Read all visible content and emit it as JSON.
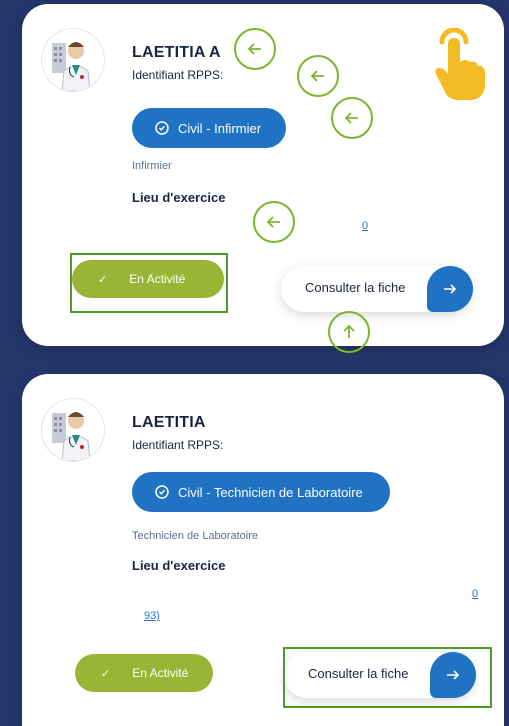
{
  "cards": [
    {
      "name": "LAETITIA A",
      "rpps_label": "Identifiant RPPS:",
      "specialty_button": "Civil - Infirmier",
      "profession": "Infirmier",
      "lieu_label": "Lieu d'exercice",
      "address_link": "0",
      "status": "En Activité",
      "consult_button": "Consulter la fiche"
    },
    {
      "name": "LAETITIA",
      "rpps_label": "Identifiant RPPS:",
      "specialty_button": "Civil - Technicien de Laboratoire",
      "profession": "Technicien de Laboratoire",
      "lieu_label": "Lieu d'exercice",
      "address_link_1": "0",
      "address_link_2": "93)",
      "status": "En Activité",
      "consult_button": "Consulter la fiche"
    }
  ],
  "icons": {
    "hint_left": "arrow-left-icon",
    "hint_up": "arrow-up-icon",
    "tap": "tap-hand-icon",
    "consult": "arrow-right-icon",
    "search": "search-badge-icon",
    "check": "check-icon"
  },
  "colors": {
    "background": "#24366b",
    "accent_blue": "#1f73c2",
    "active_green": "#9cb435",
    "hint_green": "#7bb62e",
    "hand_yellow": "#f3bb24"
  }
}
